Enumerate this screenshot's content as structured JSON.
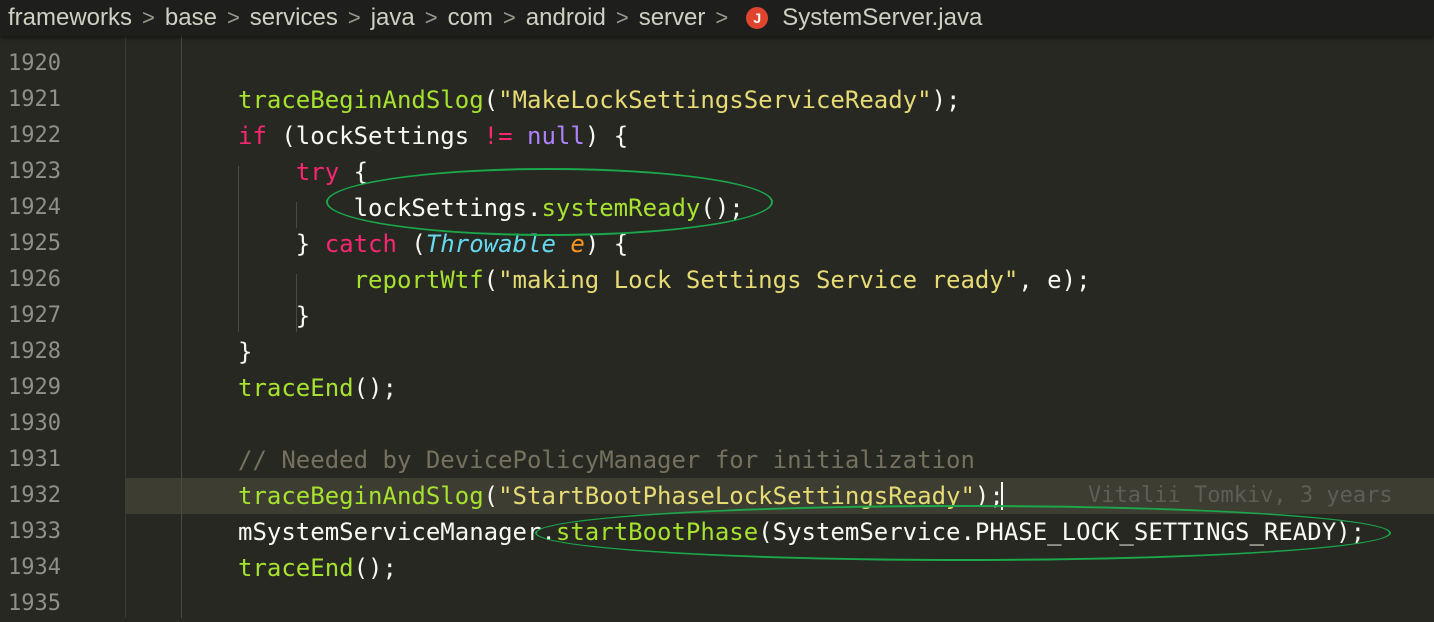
{
  "breadcrumb": {
    "items": [
      "frameworks",
      "base",
      "services",
      "java",
      "com",
      "android",
      "server"
    ],
    "file_icon": "J",
    "file_name": "SystemServer.java"
  },
  "editor": {
    "lines": [
      {
        "num": "1920"
      },
      {
        "num": "1921",
        "tokens": [
          [
            "f",
            "traceBeginAndSlog"
          ],
          [
            "",
            "("
          ],
          [
            "s",
            "\"MakeLockSettingsServiceReady\""
          ],
          [
            "",
            ");"
          ]
        ]
      },
      {
        "num": "1922",
        "tokens": [
          [
            "k",
            "if"
          ],
          [
            "",
            " (lockSettings "
          ],
          [
            "k",
            "!="
          ],
          [
            "",
            " "
          ],
          [
            "n",
            "null"
          ],
          [
            "",
            ") {"
          ]
        ]
      },
      {
        "num": "1923",
        "tokens": [
          [
            "",
            "    "
          ],
          [
            "k",
            "try"
          ],
          [
            "",
            " {"
          ]
        ]
      },
      {
        "num": "1924",
        "tokens": [
          [
            "",
            "        lockSettings."
          ],
          [
            "f",
            "systemReady"
          ],
          [
            "",
            "();"
          ]
        ]
      },
      {
        "num": "1925",
        "tokens": [
          [
            "",
            "    } "
          ],
          [
            "k",
            "catch"
          ],
          [
            "",
            " ("
          ],
          [
            "t",
            "Throwable"
          ],
          [
            "",
            " "
          ],
          [
            "p",
            "e"
          ],
          [
            "",
            ") {"
          ]
        ]
      },
      {
        "num": "1926",
        "tokens": [
          [
            "",
            "        "
          ],
          [
            "f",
            "reportWtf"
          ],
          [
            "",
            "("
          ],
          [
            "s",
            "\"making Lock Settings Service ready\""
          ],
          [
            "",
            ", e);"
          ]
        ]
      },
      {
        "num": "1927",
        "tokens": [
          [
            "",
            "    }"
          ]
        ]
      },
      {
        "num": "1928",
        "tokens": [
          [
            "",
            "}"
          ]
        ]
      },
      {
        "num": "1929",
        "tokens": [
          [
            "f",
            "traceEnd"
          ],
          [
            "",
            "();"
          ]
        ]
      },
      {
        "num": "1930"
      },
      {
        "num": "1931",
        "tokens": [
          [
            "c",
            "// Needed by DevicePolicyManager for initialization"
          ]
        ]
      },
      {
        "num": "1932",
        "tokens": [
          [
            "f",
            "traceBeginAndSlog"
          ],
          [
            "",
            "("
          ],
          [
            "s",
            "\"StartBootPhaseLockSettingsReady\""
          ],
          [
            "",
            ");"
          ]
        ],
        "active": true,
        "blame": "Vitalii Tomkiv, 3 years"
      },
      {
        "num": "1933",
        "tokens": [
          [
            "",
            "mSystemServiceManager."
          ],
          [
            "f",
            "startBootPhase"
          ],
          [
            "",
            "(SystemService.PHASE_LOCK_SETTINGS_READY);"
          ]
        ]
      },
      {
        "num": "1934",
        "tokens": [
          [
            "f",
            "traceEnd"
          ],
          [
            "",
            "();"
          ]
        ]
      },
      {
        "num": "1935"
      }
    ]
  },
  "colors": {
    "background": "#272822",
    "keyword": "#f92672",
    "function": "#a6e22e",
    "string": "#e6db74",
    "comment": "#75715e",
    "annotation_circle": "#1aa84a"
  }
}
